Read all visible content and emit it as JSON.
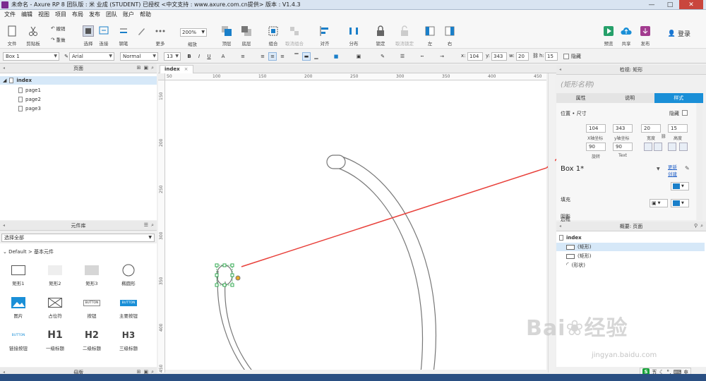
{
  "window": {
    "title": "未命名 - Axure RP 8 团队版 : 米 业成 (STUDENT) 已授权      <中文支持 : www.axure.com.cn提供> 版本 : V1.4.3",
    "controls": [
      "—",
      "□",
      "✕"
    ]
  },
  "menu": [
    "文件",
    "编辑",
    "视图",
    "项目",
    "布局",
    "发布",
    "团队",
    "账户",
    "帮助"
  ],
  "toolbar": {
    "file": "文件",
    "clipboard": "剪贴板",
    "undo": "撤销",
    "redo": "重做",
    "select": "选择",
    "connect": "连接",
    "pen": "钢笔",
    "more": "更多",
    "zoom_value": "200%",
    "zoom_label": "缩放",
    "top": "顶层",
    "bottom": "底层",
    "group": "组合",
    "ungroup": "取消组合",
    "align": "对齐",
    "distribute": "分布",
    "lock": "锁定",
    "unlock": "取消锁定",
    "left": "左",
    "right": "右",
    "preview": "预览",
    "share": "共享",
    "publish": "发布",
    "login": "登录"
  },
  "format": {
    "style": "Box 1",
    "font": "Arial",
    "weight": "Normal",
    "size": "13",
    "x_label": "x:",
    "x": "104",
    "y_label": "y:",
    "y": "343",
    "w_label": "w:",
    "w": "20",
    "h_label": "h:",
    "h": "15",
    "hidden": "隐藏"
  },
  "pages_panel": {
    "title": "页面",
    "pages": [
      "index",
      "page1",
      "page2",
      "page3"
    ]
  },
  "widgets_panel": {
    "title": "元件库",
    "library": "选择全部",
    "category": "Default > 基本元件",
    "items": [
      {
        "name": "矩形1"
      },
      {
        "name": "矩形2"
      },
      {
        "name": "矩形3"
      },
      {
        "name": "椭圆形"
      },
      {
        "name": "图片"
      },
      {
        "name": "占位符"
      },
      {
        "name": "按钮",
        "text": "BUTTON"
      },
      {
        "name": "主要按钮",
        "text": "BUTTON"
      },
      {
        "name": "链接按钮",
        "text": "BUTTON"
      },
      {
        "name": "一级标题",
        "text": "H1"
      },
      {
        "name": "二级标题",
        "text": "H2"
      },
      {
        "name": "三级标题",
        "text": "H3"
      }
    ]
  },
  "masters_panel": {
    "title": "母版"
  },
  "canvas": {
    "tab": "index",
    "ruler_h": [
      "50",
      "100",
      "150",
      "200",
      "250",
      "300",
      "350",
      "400",
      "450",
      "500",
      "550",
      "600"
    ],
    "ruler_v": [
      "150",
      "200",
      "250",
      "300",
      "350",
      "400",
      "450"
    ]
  },
  "inspector": {
    "title": "检视: 矩形",
    "name_placeholder": "(矩形名称)",
    "tabs": [
      "属性",
      "说明",
      "样式"
    ],
    "position_size": "位置 • 尺寸",
    "hidden": "隐藏",
    "x": "104",
    "y": "343",
    "w": "20",
    "h": "15",
    "x_label": "X轴坐标",
    "y_label": "y轴坐标",
    "w_label": "宽度",
    "h_label": "高度",
    "rotate": "90",
    "rotate_label": "旋转",
    "text_rotate": "90",
    "text_label": "Text",
    "style_name": "Box 1*",
    "update": "更新",
    "create": "创建",
    "fill": "填充",
    "shadow": "阴影",
    "border": "边框",
    "fill_color": "#1a7fc9"
  },
  "outline_panel": {
    "title": "概要: 页面",
    "root": "index",
    "items": [
      "(矩形)",
      "(矩形)",
      "(形状)"
    ]
  },
  "ime": {
    "mode": "五"
  }
}
